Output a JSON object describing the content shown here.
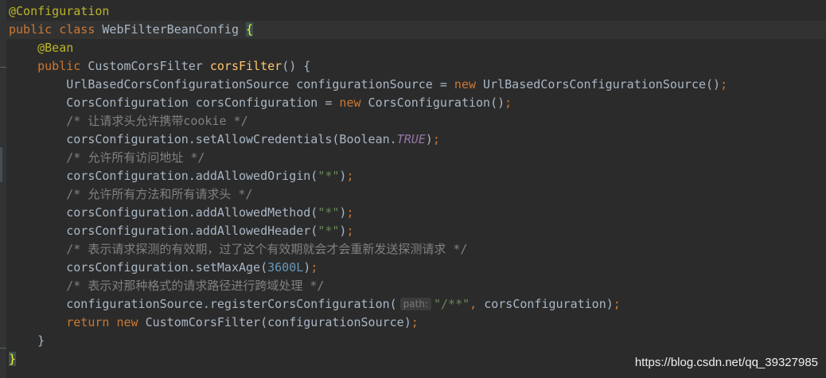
{
  "editor": {
    "lines": [
      {
        "indent": "",
        "tokens": [
          {
            "text": "@Configuration",
            "type": "anno"
          }
        ]
      },
      {
        "indent": "",
        "current": true,
        "tokens": [
          {
            "text": "public ",
            "type": "kw"
          },
          {
            "text": "class ",
            "type": "kw"
          },
          {
            "text": "WebFilterBeanConfig ",
            "type": "plain"
          },
          {
            "text": "{",
            "type": "brace-hl"
          }
        ]
      },
      {
        "indent": "    ",
        "tokens": [
          {
            "text": "@Bean",
            "type": "anno"
          }
        ]
      },
      {
        "indent": "    ",
        "tokens": [
          {
            "text": "public ",
            "type": "kw"
          },
          {
            "text": "CustomCorsFilter ",
            "type": "plain"
          },
          {
            "text": "corsFilter",
            "type": "fn"
          },
          {
            "text": "() {",
            "type": "plain"
          }
        ]
      },
      {
        "indent": "        ",
        "tokens": [
          {
            "text": "UrlBasedCorsConfigurationSource configurationSource = ",
            "type": "plain"
          },
          {
            "text": "new ",
            "type": "kw"
          },
          {
            "text": "UrlBasedCorsConfigurationSource()",
            "type": "plain"
          },
          {
            "text": ";",
            "type": "kw"
          }
        ]
      },
      {
        "indent": "        ",
        "tokens": [
          {
            "text": "CorsConfiguration corsConfiguration = ",
            "type": "plain"
          },
          {
            "text": "new ",
            "type": "kw"
          },
          {
            "text": "CorsConfiguration()",
            "type": "plain"
          },
          {
            "text": ";",
            "type": "kw"
          }
        ]
      },
      {
        "indent": "        ",
        "tokens": [
          {
            "text": "/* 让请求头允许携带cookie */",
            "type": "cmt"
          }
        ]
      },
      {
        "indent": "        ",
        "tokens": [
          {
            "text": "corsConfiguration.setAllowCredentials(Boolean.",
            "type": "plain"
          },
          {
            "text": "TRUE",
            "type": "const"
          },
          {
            "text": ")",
            "type": "plain"
          },
          {
            "text": ";",
            "type": "kw"
          }
        ]
      },
      {
        "indent": "        ",
        "tokens": [
          {
            "text": "/* 允许所有访问地址 */",
            "type": "cmt"
          }
        ]
      },
      {
        "indent": "        ",
        "tokens": [
          {
            "text": "corsConfiguration.addAllowedOrigin(",
            "type": "plain"
          },
          {
            "text": "\"*\"",
            "type": "str"
          },
          {
            "text": ")",
            "type": "plain"
          },
          {
            "text": ";",
            "type": "kw"
          }
        ]
      },
      {
        "indent": "        ",
        "tokens": [
          {
            "text": "/* 允许所有方法和所有请求头 */",
            "type": "cmt"
          }
        ]
      },
      {
        "indent": "        ",
        "tokens": [
          {
            "text": "corsConfiguration.addAllowedMethod(",
            "type": "plain"
          },
          {
            "text": "\"*\"",
            "type": "str"
          },
          {
            "text": ")",
            "type": "plain"
          },
          {
            "text": ";",
            "type": "kw"
          }
        ]
      },
      {
        "indent": "        ",
        "tokens": [
          {
            "text": "corsConfiguration.addAllowedHeader(",
            "type": "plain"
          },
          {
            "text": "\"*\"",
            "type": "str"
          },
          {
            "text": ")",
            "type": "plain"
          },
          {
            "text": ";",
            "type": "kw"
          }
        ]
      },
      {
        "indent": "        ",
        "tokens": [
          {
            "text": "/* 表示请求探测的有效期，过了这个有效期就会才会重新发送探测请求 */",
            "type": "cmt"
          }
        ]
      },
      {
        "indent": "        ",
        "tokens": [
          {
            "text": "corsConfiguration.setMaxAge(",
            "type": "plain"
          },
          {
            "text": "3600L",
            "type": "num"
          },
          {
            "text": ")",
            "type": "plain"
          },
          {
            "text": ";",
            "type": "kw"
          }
        ]
      },
      {
        "indent": "        ",
        "tokens": [
          {
            "text": "/* 表示对那种格式的请求路径进行跨域处理 */",
            "type": "cmt"
          }
        ]
      },
      {
        "indent": "        ",
        "tokens": [
          {
            "text": "configurationSource.registerCorsConfiguration(",
            "type": "plain"
          },
          {
            "text": "path:",
            "type": "hint"
          },
          {
            "text": "\"/**\"",
            "type": "str"
          },
          {
            "text": ", ",
            "type": "kw"
          },
          {
            "text": "corsConfiguration)",
            "type": "plain"
          },
          {
            "text": ";",
            "type": "kw"
          }
        ]
      },
      {
        "indent": "        ",
        "tokens": [
          {
            "text": "return ",
            "type": "kw"
          },
          {
            "text": "new ",
            "type": "kw"
          },
          {
            "text": "CustomCorsFilter(configurationSource)",
            "type": "plain"
          },
          {
            "text": ";",
            "type": "kw"
          }
        ]
      },
      {
        "indent": "    ",
        "tokens": [
          {
            "text": "}",
            "type": "plain"
          }
        ]
      },
      {
        "indent": "",
        "tokens": [
          {
            "text": "}",
            "type": "brace-hl"
          }
        ]
      }
    ]
  },
  "watermark": {
    "text": "https://blog.csdn.net/qq_39327985"
  },
  "colors": {
    "background": "#2b2b2b",
    "keyword": "#cc7832",
    "annotation": "#bbb529",
    "method": "#ffc66d",
    "string": "#6a8759",
    "number": "#6897bb",
    "constant": "#9876aa",
    "comment": "#808080",
    "default": "#a9b7c6"
  }
}
